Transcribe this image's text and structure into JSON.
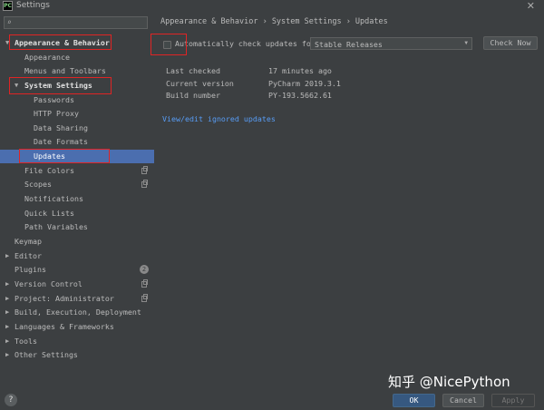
{
  "window": {
    "title": "Settings",
    "app_icon_label": "PC"
  },
  "sidebar": {
    "search_placeholder": "",
    "items": [
      {
        "label": "Appearance & Behavior",
        "bold": true
      },
      {
        "label": "Appearance"
      },
      {
        "label": "Menus and Toolbars"
      },
      {
        "label": "System Settings",
        "bold": true
      },
      {
        "label": "Passwords"
      },
      {
        "label": "HTTP Proxy"
      },
      {
        "label": "Data Sharing"
      },
      {
        "label": "Date Formats"
      },
      {
        "label": "Updates",
        "selected": true
      },
      {
        "label": "File Colors"
      },
      {
        "label": "Scopes"
      },
      {
        "label": "Notifications"
      },
      {
        "label": "Quick Lists"
      },
      {
        "label": "Path Variables"
      },
      {
        "label": "Keymap"
      },
      {
        "label": "Editor"
      },
      {
        "label": "Plugins",
        "count": "2"
      },
      {
        "label": "Version Control"
      },
      {
        "label": "Project: Administrator"
      },
      {
        "label": "Build, Execution, Deployment"
      },
      {
        "label": "Languages & Frameworks"
      },
      {
        "label": "Tools"
      },
      {
        "label": "Other Settings"
      }
    ]
  },
  "main": {
    "breadcrumb": "Appearance & Behavior  ›  System Settings  ›  Updates",
    "check_label": "Automatically check updates for",
    "channel_selected": "Stable Releases",
    "check_now": "Check Now",
    "info": [
      {
        "key": "Last checked",
        "value": "17 minutes ago"
      },
      {
        "key": "Current version",
        "value": "PyCharm 2019.3.1"
      },
      {
        "key": "Build number",
        "value": "PY-193.5662.61"
      }
    ],
    "ignored_link": "View/edit ignored updates"
  },
  "footer": {
    "help": "?",
    "ok": "OK",
    "cancel": "Cancel",
    "apply": "Apply"
  },
  "watermark": "知乎 @NicePython",
  "colors": {
    "background": "#3c3f41",
    "selection": "#4b6eaf",
    "link": "#589df6",
    "highlight_box": "#e02424"
  }
}
